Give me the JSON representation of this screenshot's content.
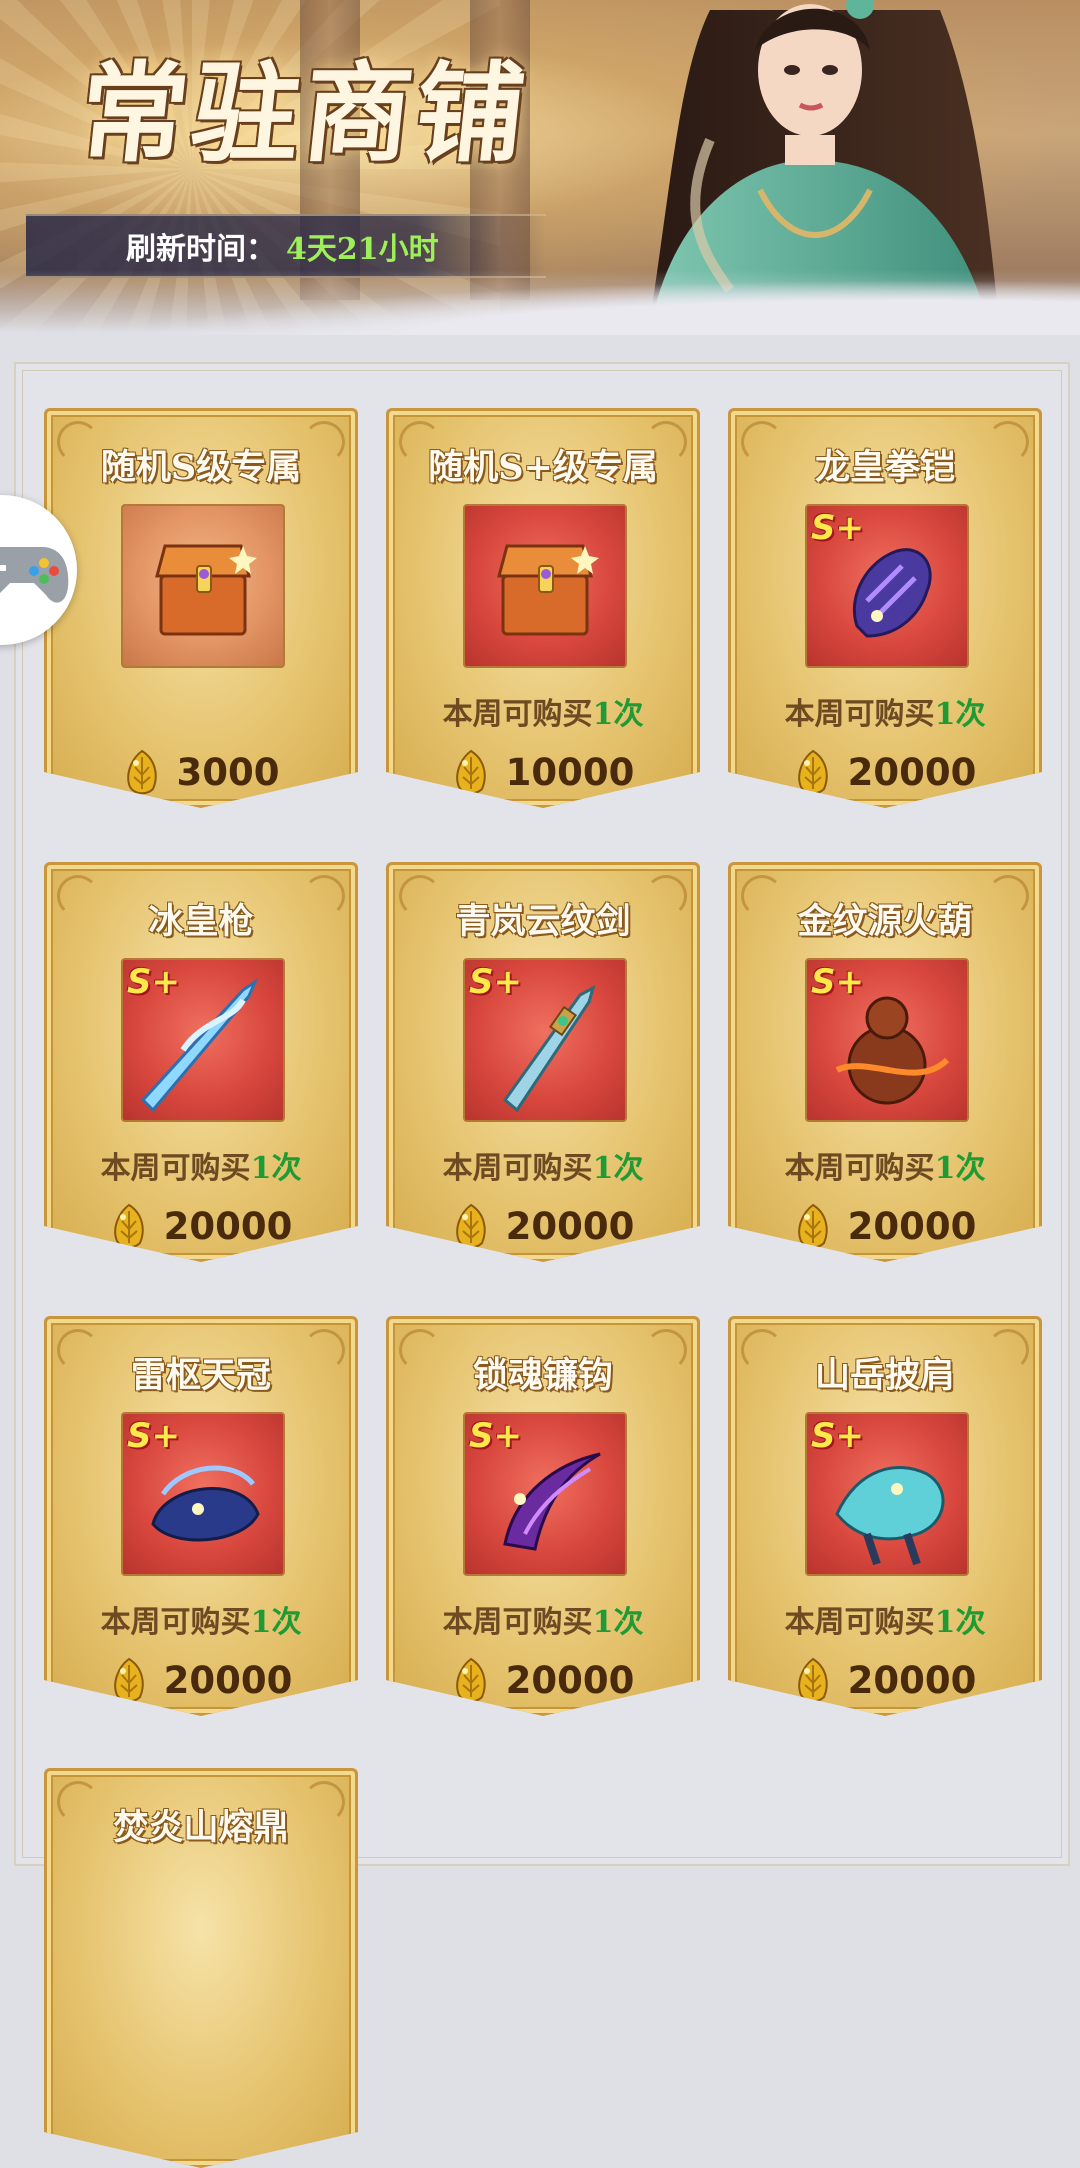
{
  "header": {
    "title": "常驻商铺",
    "refresh_label": "刷新时间：",
    "refresh_value": "4天21小时"
  },
  "colors": {
    "accent_green": "#1f9a34",
    "refresh_green": "#9ef05a",
    "card_gold": "#e6c470",
    "item_red": "#d9483e"
  },
  "items": [
    {
      "name": "随机S级专属",
      "limit_prefix": "",
      "limit_count": "",
      "limit_suffix": "",
      "price": "3000",
      "icon": "treasure-chest-icon",
      "badge": ""
    },
    {
      "name": "随机S+级专属",
      "limit_prefix": "本周可购买",
      "limit_count": "1",
      "limit_suffix": "次",
      "price": "10000",
      "icon": "treasure-chest-icon",
      "badge": ""
    },
    {
      "name": "龙皇拳铠",
      "limit_prefix": "本周可购买",
      "limit_count": "1",
      "limit_suffix": "次",
      "price": "20000",
      "icon": "gauntlet-icon",
      "badge": "S+"
    },
    {
      "name": "冰皇枪",
      "limit_prefix": "本周可购买",
      "limit_count": "1",
      "limit_suffix": "次",
      "price": "20000",
      "icon": "ice-spear-icon",
      "badge": "S+"
    },
    {
      "name": "青岚云纹剑",
      "limit_prefix": "本周可购买",
      "limit_count": "1",
      "limit_suffix": "次",
      "price": "20000",
      "icon": "sword-icon",
      "badge": "S+"
    },
    {
      "name": "金纹源火葫",
      "limit_prefix": "本周可购买",
      "limit_count": "1",
      "limit_suffix": "次",
      "price": "20000",
      "icon": "gourd-icon",
      "badge": "S+"
    },
    {
      "name": "雷枢天冠",
      "limit_prefix": "本周可购买",
      "limit_count": "1",
      "limit_suffix": "次",
      "price": "20000",
      "icon": "crown-icon",
      "badge": "S+"
    },
    {
      "name": "锁魂镰钩",
      "limit_prefix": "本周可购买",
      "limit_count": "1",
      "limit_suffix": "次",
      "price": "20000",
      "icon": "sickle-icon",
      "badge": "S+"
    },
    {
      "name": "山岳披肩",
      "limit_prefix": "本周可购买",
      "limit_count": "1",
      "limit_suffix": "次",
      "price": "20000",
      "icon": "shawl-icon",
      "badge": "S+"
    },
    {
      "name": "焚炎山熔鼎",
      "limit_prefix": "",
      "limit_count": "",
      "limit_suffix": "",
      "price": "",
      "icon": "",
      "badge": ""
    }
  ]
}
